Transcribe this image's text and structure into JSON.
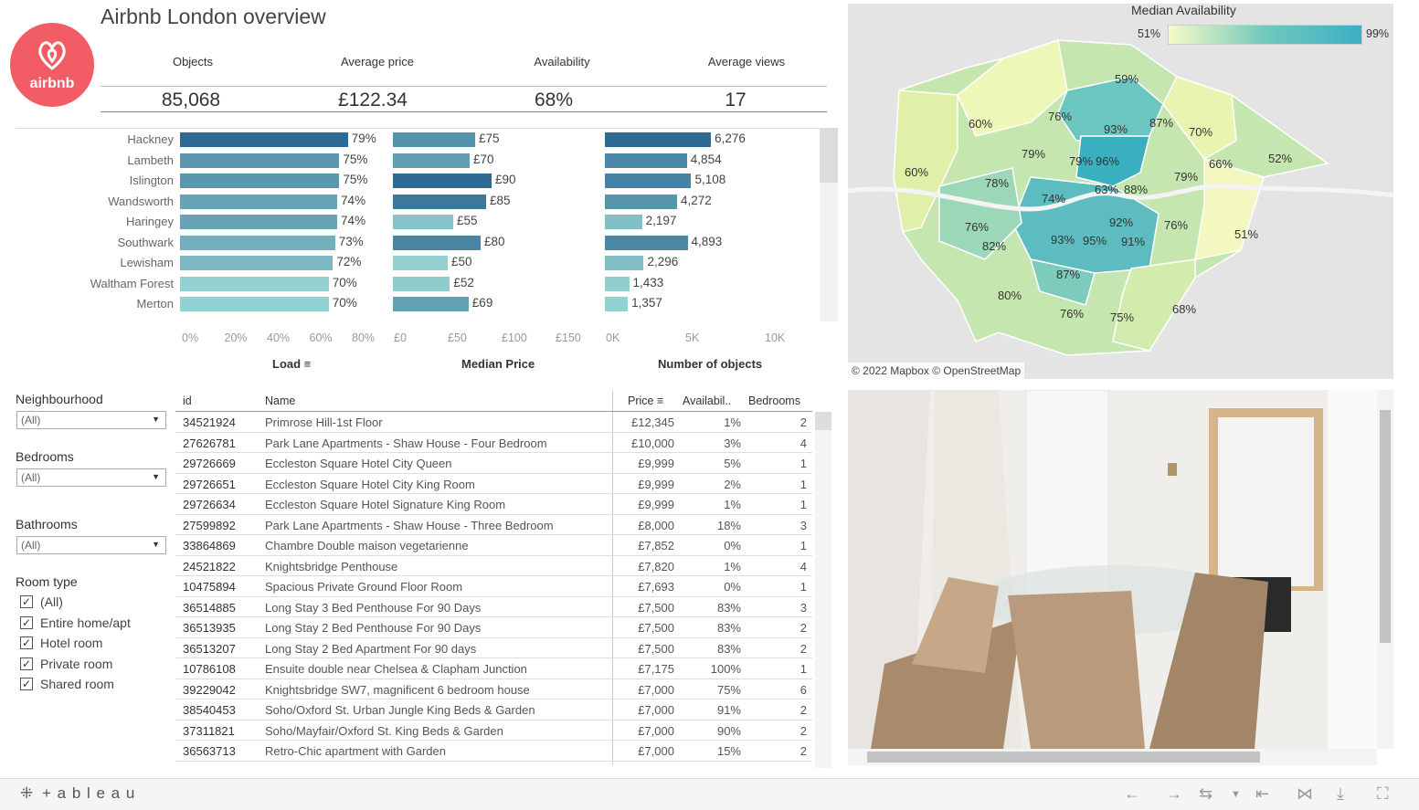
{
  "header": {
    "title": "Airbnb London overview",
    "logo_text": "airbnb"
  },
  "kpis": [
    {
      "label": "Objects",
      "value": "85,068"
    },
    {
      "label": "Average price",
      "value": "£122.34"
    },
    {
      "label": "Availability",
      "value": "68%"
    },
    {
      "label": "Average views",
      "value": "17"
    }
  ],
  "chart_data": {
    "type": "bar",
    "categories": [
      "Hackney",
      "Lambeth",
      "Islington",
      "Wandsworth",
      "Haringey",
      "Southwark",
      "Lewisham",
      "Waltham Forest",
      "Merton"
    ],
    "series": [
      {
        "name": "Load",
        "values": [
          79,
          75,
          75,
          74,
          74,
          73,
          72,
          70,
          70
        ],
        "labels": [
          "79%",
          "75%",
          "75%",
          "74%",
          "74%",
          "73%",
          "72%",
          "70%",
          "70%"
        ]
      },
      {
        "name": "Median Price",
        "values": [
          75,
          70,
          90,
          85,
          55,
          80,
          50,
          52,
          69
        ],
        "labels": [
          "£75",
          "£70",
          "£90",
          "£85",
          "£55",
          "£80",
          "£50",
          "£52",
          "£69"
        ]
      },
      {
        "name": "Number of objects",
        "values": [
          6276,
          4854,
          5108,
          4272,
          2197,
          4893,
          2296,
          1433,
          1357
        ],
        "labels": [
          "6,276",
          "4,854",
          "5,108",
          "4,272",
          "2,197",
          "4,893",
          "2,296",
          "1,433",
          "1,357"
        ]
      }
    ],
    "axes": {
      "load_ticks": [
        "0%",
        "20%",
        "40%",
        "60%",
        "80%"
      ],
      "price_ticks": [
        "£0",
        "£50",
        "£100",
        "£150"
      ],
      "objects_ticks": [
        "0K",
        "5K",
        "10K"
      ]
    },
    "axis_titles": {
      "load": "Load",
      "price": "Median Price",
      "objects": "Number of objects"
    }
  },
  "filters": {
    "neighbourhood": {
      "label": "Neighbourhood",
      "value": "(All)"
    },
    "bedrooms": {
      "label": "Bedrooms",
      "value": "(All)"
    },
    "bathrooms": {
      "label": "Bathrooms",
      "value": "(All)"
    },
    "room_type": {
      "label": "Room type",
      "options": [
        "(All)",
        "Entire home/apt",
        "Hotel room",
        "Private room",
        "Shared room"
      ]
    }
  },
  "table": {
    "headers": {
      "id": "id",
      "name": "Name",
      "price": "Price",
      "avail": "Availabil..",
      "bedrooms": "Bedrooms"
    },
    "rows": [
      [
        "34521924",
        "Primrose Hill-1st Floor",
        "£12,345",
        "1%",
        "2"
      ],
      [
        "27626781",
        "Park Lane Apartments - Shaw House - Four Bedroom",
        "£10,000",
        "3%",
        "4"
      ],
      [
        "29726669",
        "Eccleston Square Hotel City Queen",
        "£9,999",
        "5%",
        "1"
      ],
      [
        "29726651",
        "Eccleston Square Hotel City King Room",
        "£9,999",
        "2%",
        "1"
      ],
      [
        "29726634",
        "Eccleston Square Hotel Signature King Room",
        "£9,999",
        "1%",
        "1"
      ],
      [
        "27599892",
        "Park Lane Apartments - Shaw House - Three Bedroom",
        "£8,000",
        "18%",
        "3"
      ],
      [
        "33864869",
        "Chambre Double maison vegetarienne",
        "£7,852",
        "0%",
        "1"
      ],
      [
        "24521822",
        "Knightsbridge Penthouse",
        "£7,820",
        "1%",
        "4"
      ],
      [
        "10475894",
        "Spacious Private Ground Floor Room",
        "£7,693",
        "0%",
        "1"
      ],
      [
        "36514885",
        "Long Stay 3 Bed Penthouse For 90 Days",
        "£7,500",
        "83%",
        "3"
      ],
      [
        "36513935",
        "Long Stay 2 Bed Penthouse For 90 Days",
        "£7,500",
        "83%",
        "2"
      ],
      [
        "36513207",
        "Long Stay 2 Bed Apartment For 90 days",
        "£7,500",
        "83%",
        "2"
      ],
      [
        "10786108",
        "Ensuite double near Chelsea & Clapham Junction",
        "£7,175",
        "100%",
        "1"
      ],
      [
        "39229042",
        "Knightsbridge SW7,  magnificent  6 bedroom house",
        "£7,000",
        "75%",
        "6"
      ],
      [
        "38540453",
        "Soho/Oxford St. Urban Jungle King Beds & Garden",
        "£7,000",
        "91%",
        "2"
      ],
      [
        "37311821",
        "Soho/Mayfair/Oxford St. King Beds & Garden",
        "£7,000",
        "90%",
        "2"
      ],
      [
        "36563713",
        "Retro-Chic apartment with Garden",
        "£7,000",
        "15%",
        "2"
      ]
    ]
  },
  "map": {
    "legend_title": "Median Availability",
    "legend_min": "51%",
    "legend_max": "99%",
    "attribution": "© 2022 Mapbox  © OpenStreetMap",
    "labels": [
      "59%",
      "76%",
      "93%",
      "87%",
      "60%",
      "70%",
      "79%",
      "79%",
      "96%",
      "66%",
      "52%",
      "60%",
      "78%",
      "74%",
      "63%",
      "88%",
      "79%",
      "76%",
      "92%",
      "76%",
      "82%",
      "93%",
      "95%",
      "91%",
      "51%",
      "87%",
      "80%",
      "76%",
      "75%",
      "68%"
    ]
  },
  "toolbar": {
    "brand": "+ a b l e a u"
  },
  "colors": {
    "accent": "#f25c65",
    "dark_bar": "#2e6b94",
    "mid_bar": "#3d97b0",
    "light_bar": "#93d1d0"
  }
}
